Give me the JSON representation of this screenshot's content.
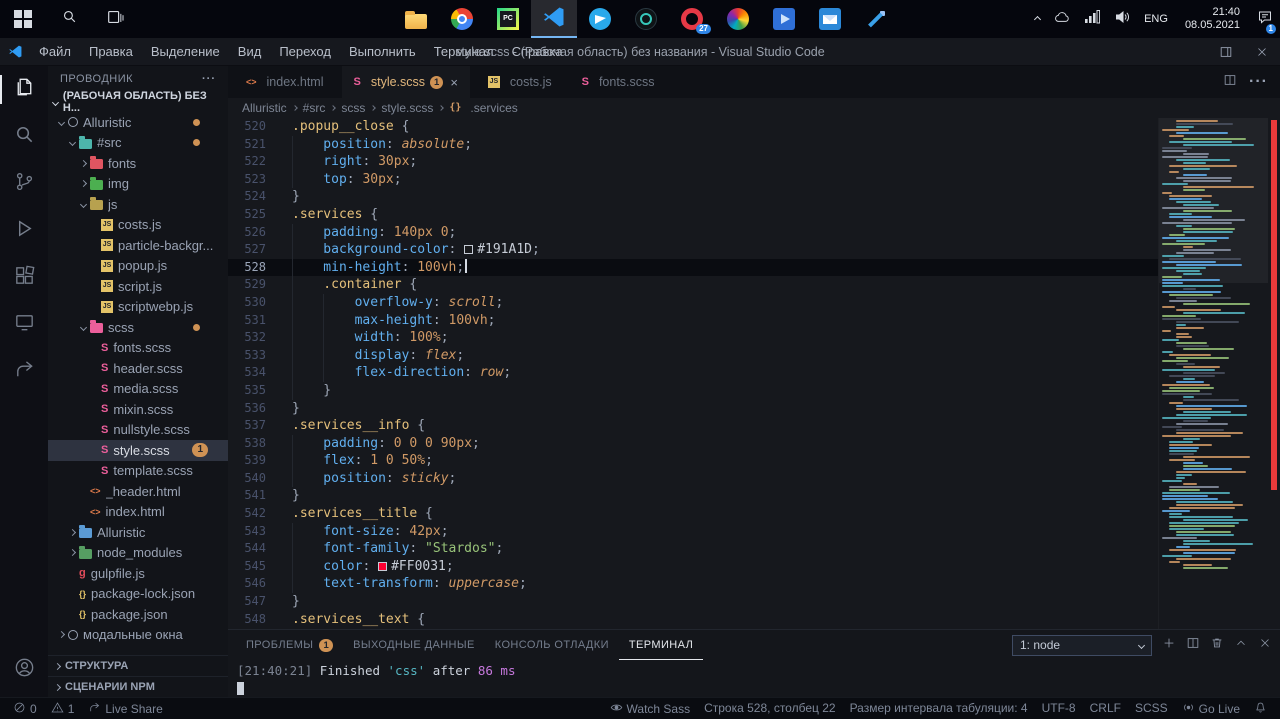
{
  "colors": {
    "accent": "#d19a66",
    "error_marker": "#e83a3a",
    "selection_bg": "#2e3340",
    "active_tab_text": "#e2b77d"
  },
  "taskbar": {
    "apps": [
      {
        "id": "file-explorer"
      },
      {
        "id": "chrome"
      },
      {
        "id": "pycharm"
      },
      {
        "id": "vscode",
        "active": true
      },
      {
        "id": "telegram"
      },
      {
        "id": "obs"
      },
      {
        "id": "opera",
        "badge": "27"
      },
      {
        "id": "photos"
      },
      {
        "id": "films-tv"
      },
      {
        "id": "mail"
      },
      {
        "id": "paint"
      }
    ],
    "tray": {
      "lang": "ENG",
      "time": "21:40",
      "date": "08.05.2021",
      "notification_badge": "1"
    }
  },
  "titlebar": {
    "menus": [
      "Файл",
      "Правка",
      "Выделение",
      "Вид",
      "Переход",
      "Выполнить",
      "Терминал",
      "Справка"
    ],
    "title": "style.scss - (Рабочая область) без названия - Visual Studio Code"
  },
  "activitybar": {
    "items": [
      {
        "id": "explorer",
        "active": true
      },
      {
        "id": "search"
      },
      {
        "id": "source-control"
      },
      {
        "id": "run-debug"
      },
      {
        "id": "extensions"
      },
      {
        "id": "remote-explorer"
      },
      {
        "id": "live-share"
      }
    ],
    "bottom": [
      {
        "id": "account"
      }
    ]
  },
  "sidebar": {
    "title": "ПРОВОДНИК",
    "workspace_label": "(РАБОЧАЯ ОБЛАСТЬ) БЕЗ Н...",
    "tree": [
      {
        "l": "Alluristic",
        "ic": "ring",
        "ind": 0,
        "ch": "d",
        "dot": true
      },
      {
        "l": "#src",
        "ic": "folder",
        "col": "#4db6ac",
        "ind": 1,
        "ch": "d",
        "dot": true
      },
      {
        "l": "fonts",
        "ic": "folder",
        "col": "#e05561",
        "ind": 2,
        "ch": "r"
      },
      {
        "l": "img",
        "ic": "folder",
        "col": "#4caf50",
        "ind": 2,
        "ch": "r"
      },
      {
        "l": "js",
        "ic": "folder",
        "col": "#b7a14f",
        "ind": 2,
        "ch": "d"
      },
      {
        "l": "costs.js",
        "ic": "js",
        "ind": 3
      },
      {
        "l": "particle-backgr...",
        "ic": "js",
        "ind": 3
      },
      {
        "l": "popup.js",
        "ic": "js",
        "ind": 3
      },
      {
        "l": "script.js",
        "ic": "js",
        "ind": 3
      },
      {
        "l": "scriptwebp.js",
        "ic": "js",
        "ind": 3
      },
      {
        "l": "scss",
        "ic": "folder",
        "col": "#ec5f9b",
        "ind": 2,
        "ch": "d",
        "dot": true
      },
      {
        "l": "fonts.scss",
        "ic": "scss",
        "ind": 3
      },
      {
        "l": "header.scss",
        "ic": "scss",
        "ind": 3
      },
      {
        "l": "media.scss",
        "ic": "scss",
        "ind": 3
      },
      {
        "l": "mixin.scss",
        "ic": "scss",
        "ind": 3
      },
      {
        "l": "nullstyle.scss",
        "ic": "scss",
        "ind": 3
      },
      {
        "l": "style.scss",
        "ic": "scss",
        "ind": 3,
        "sel": true,
        "badge": "1"
      },
      {
        "l": "template.scss",
        "ic": "scss",
        "ind": 3
      },
      {
        "l": "_header.html",
        "ic": "html",
        "ind": 2
      },
      {
        "l": "index.html",
        "ic": "html",
        "ind": 2
      },
      {
        "l": "Alluristic",
        "ic": "folder",
        "col": "#5b9bd5",
        "ind": 1,
        "ch": "r"
      },
      {
        "l": "node_modules",
        "ic": "folder",
        "col": "#569e62",
        "ind": 1,
        "ch": "r"
      },
      {
        "l": "gulpfile.js",
        "ic": "gulp",
        "ind": 1
      },
      {
        "l": "package-lock.json",
        "ic": "json",
        "ind": 1
      },
      {
        "l": "package.json",
        "ic": "json",
        "ind": 1
      },
      {
        "l": "модальные окна",
        "ic": "ring",
        "ind": 0,
        "ch": "r"
      }
    ],
    "sections": [
      "СТРУКТУРА",
      "СЦЕНАРИИ NPM"
    ]
  },
  "editor": {
    "tabs": [
      {
        "label": "index.html",
        "icon": "html"
      },
      {
        "label": "style.scss",
        "icon": "scss",
        "active": true,
        "badge": "1",
        "close": "×"
      },
      {
        "label": "costs.js",
        "icon": "js"
      },
      {
        "label": "fonts.scss",
        "icon": "scss"
      }
    ],
    "breadcrumbs": [
      {
        "label": "Alluristic"
      },
      {
        "label": "#src"
      },
      {
        "label": "scss"
      },
      {
        "label": "style.scss"
      },
      {
        "label": ".services",
        "icon": "symbol-class"
      }
    ],
    "lines": [
      {
        "n": 520,
        "i": 0,
        "t": [
          [
            "sel",
            ".popup__close"
          ],
          [
            "p",
            " {"
          ]
        ]
      },
      {
        "n": 521,
        "i": 1,
        "t": [
          [
            "prop",
            "position"
          ],
          [
            "p",
            ": "
          ],
          [
            "kw",
            "absolute"
          ],
          [
            "p",
            ";"
          ]
        ]
      },
      {
        "n": 522,
        "i": 1,
        "t": [
          [
            "prop",
            "right"
          ],
          [
            "p",
            ": "
          ],
          [
            "num",
            "30px"
          ],
          [
            "p",
            ";"
          ]
        ]
      },
      {
        "n": 523,
        "i": 1,
        "t": [
          [
            "prop",
            "top"
          ],
          [
            "p",
            ": "
          ],
          [
            "num",
            "30px"
          ],
          [
            "p",
            ";"
          ]
        ]
      },
      {
        "n": 524,
        "i": 0,
        "t": [
          [
            "p",
            "}"
          ]
        ]
      },
      {
        "n": 525,
        "i": 0,
        "t": [
          [
            "sel",
            ".services"
          ],
          [
            "p",
            " {"
          ]
        ]
      },
      {
        "n": 526,
        "i": 1,
        "t": [
          [
            "prop",
            "padding"
          ],
          [
            "p",
            ": "
          ],
          [
            "num",
            "140px 0"
          ],
          [
            "p",
            ";"
          ]
        ]
      },
      {
        "n": 527,
        "i": 1,
        "t": [
          [
            "prop",
            "background-color"
          ],
          [
            "p",
            ": "
          ],
          [
            "sw",
            "#191A1D"
          ],
          [
            "hex",
            "#191A1D"
          ],
          [
            "p",
            ";"
          ]
        ]
      },
      {
        "n": 528,
        "i": 1,
        "cur": true,
        "t": [
          [
            "prop",
            "min-height"
          ],
          [
            "p",
            ": "
          ],
          [
            "num",
            "100vh"
          ],
          [
            "p",
            ";"
          ]
        ]
      },
      {
        "n": 529,
        "i": 1,
        "t": [
          [
            "sel",
            ".container"
          ],
          [
            "p",
            " {"
          ]
        ]
      },
      {
        "n": 530,
        "i": 2,
        "t": [
          [
            "prop",
            "overflow-y"
          ],
          [
            "p",
            ": "
          ],
          [
            "kw",
            "scroll"
          ],
          [
            "p",
            ";"
          ]
        ]
      },
      {
        "n": 531,
        "i": 2,
        "t": [
          [
            "prop",
            "max-height"
          ],
          [
            "p",
            ": "
          ],
          [
            "num",
            "100vh"
          ],
          [
            "p",
            ";"
          ]
        ]
      },
      {
        "n": 532,
        "i": 2,
        "t": [
          [
            "prop",
            "width"
          ],
          [
            "p",
            ": "
          ],
          [
            "num",
            "100%"
          ],
          [
            "p",
            ";"
          ]
        ]
      },
      {
        "n": 533,
        "i": 2,
        "t": [
          [
            "prop",
            "display"
          ],
          [
            "p",
            ": "
          ],
          [
            "kw",
            "flex"
          ],
          [
            "p",
            ";"
          ]
        ]
      },
      {
        "n": 534,
        "i": 2,
        "t": [
          [
            "prop",
            "flex-direction"
          ],
          [
            "p",
            ": "
          ],
          [
            "kw",
            "row"
          ],
          [
            "p",
            ";"
          ]
        ]
      },
      {
        "n": 535,
        "i": 1,
        "t": [
          [
            "p",
            "}"
          ]
        ]
      },
      {
        "n": 536,
        "i": 0,
        "t": [
          [
            "p",
            "}"
          ]
        ]
      },
      {
        "n": 537,
        "i": 0,
        "t": [
          [
            "sel",
            ".services__info"
          ],
          [
            "p",
            " {"
          ]
        ]
      },
      {
        "n": 538,
        "i": 1,
        "t": [
          [
            "prop",
            "padding"
          ],
          [
            "p",
            ": "
          ],
          [
            "num",
            "0 0 0 90px"
          ],
          [
            "p",
            ";"
          ]
        ]
      },
      {
        "n": 539,
        "i": 1,
        "t": [
          [
            "prop",
            "flex"
          ],
          [
            "p",
            ": "
          ],
          [
            "num",
            "1 0 50%"
          ],
          [
            "p",
            ";"
          ]
        ]
      },
      {
        "n": 540,
        "i": 1,
        "t": [
          [
            "prop",
            "position"
          ],
          [
            "p",
            ": "
          ],
          [
            "kw",
            "sticky"
          ],
          [
            "p",
            ";"
          ]
        ]
      },
      {
        "n": 541,
        "i": 0,
        "t": [
          [
            "p",
            "}"
          ]
        ]
      },
      {
        "n": 542,
        "i": 0,
        "t": [
          [
            "sel",
            ".services__title"
          ],
          [
            "p",
            " {"
          ]
        ]
      },
      {
        "n": 543,
        "i": 1,
        "t": [
          [
            "prop",
            "font-size"
          ],
          [
            "p",
            ": "
          ],
          [
            "num",
            "42px"
          ],
          [
            "p",
            ";"
          ]
        ]
      },
      {
        "n": 544,
        "i": 1,
        "t": [
          [
            "prop",
            "font-family"
          ],
          [
            "p",
            ": "
          ],
          [
            "str",
            "\"Stardos\""
          ],
          [
            "p",
            ";"
          ]
        ]
      },
      {
        "n": 545,
        "i": 1,
        "t": [
          [
            "prop",
            "color"
          ],
          [
            "p",
            ": "
          ],
          [
            "sw",
            "#FF0031"
          ],
          [
            "hex",
            "#FF0031"
          ],
          [
            "p",
            ";"
          ]
        ]
      },
      {
        "n": 546,
        "i": 1,
        "t": [
          [
            "prop",
            "text-transform"
          ],
          [
            "p",
            ": "
          ],
          [
            "kw",
            "uppercase"
          ],
          [
            "p",
            ";"
          ]
        ]
      },
      {
        "n": 547,
        "i": 0,
        "t": [
          [
            "p",
            "}"
          ]
        ]
      },
      {
        "n": 548,
        "i": 0,
        "t": [
          [
            "sel",
            ".services__text"
          ],
          [
            "p",
            " {"
          ]
        ]
      }
    ]
  },
  "panel": {
    "tabs": [
      {
        "label": "ПРОБЛЕМЫ",
        "badge": "1"
      },
      {
        "label": "ВЫХОДНЫЕ ДАННЫЕ"
      },
      {
        "label": "КОНСОЛЬ ОТЛАДКИ"
      },
      {
        "label": "ТЕРМИНАЛ",
        "active": true
      }
    ],
    "shell_selector": "1: node",
    "terminal": [
      {
        "t": [
          [
            "dim",
            "[21:40:21] "
          ],
          [
            "fg",
            "Finished "
          ],
          [
            "cyan",
            "'css'"
          ],
          [
            "fg",
            " after "
          ],
          [
            "mag",
            "86 ms"
          ]
        ]
      },
      {
        "t": [],
        "cursor": true
      }
    ]
  },
  "statusbar": {
    "left": [
      {
        "icon": "error",
        "label": "0"
      },
      {
        "icon": "warning",
        "label": "1"
      },
      {
        "icon": "live-share",
        "label": "Live Share"
      }
    ],
    "right": [
      {
        "icon": "eye",
        "label": "Watch Sass"
      },
      {
        "label": "Строка 528, столбец 22"
      },
      {
        "label": "Размер интервала табуляции: 4"
      },
      {
        "label": "UTF-8"
      },
      {
        "label": "CRLF"
      },
      {
        "label": "SCSS"
      },
      {
        "icon": "broadcast",
        "label": "Go Live"
      },
      {
        "icon": "bell",
        "label": ""
      }
    ]
  }
}
